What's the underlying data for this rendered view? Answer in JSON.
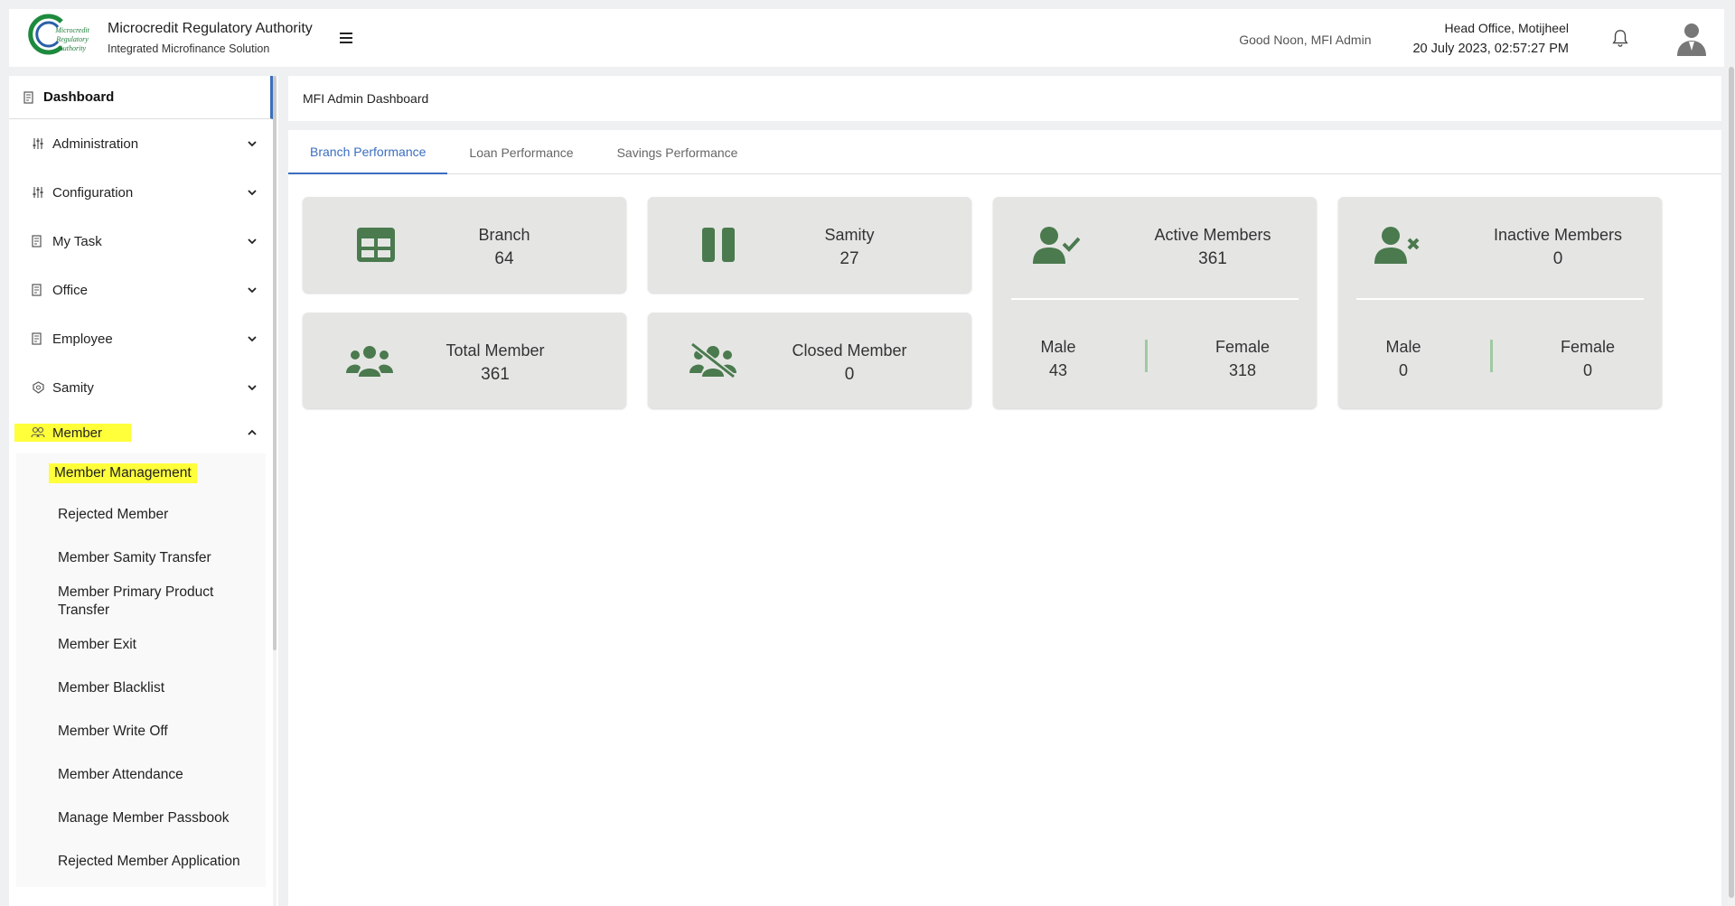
{
  "header": {
    "logo_text": [
      "Microcredit",
      "Regulatory",
      "Authority"
    ],
    "title": "Microcredit Regulatory Authority",
    "subtitle": "Integrated Microfinance Solution",
    "greeting": "Good Noon, MFI Admin",
    "office": "Head Office, Motijheel",
    "datetime": "20 July 2023, 02:57:27 PM",
    "icons": {
      "menu": "hamburger-icon",
      "notify": "bell-icon",
      "user": "user-avatar-icon"
    }
  },
  "sidebar": {
    "dashboard": "Dashboard",
    "items": [
      {
        "label": "Administration",
        "icon": "sliders-icon"
      },
      {
        "label": "Configuration",
        "icon": "sliders-icon"
      },
      {
        "label": "My Task",
        "icon": "task-icon"
      },
      {
        "label": "Office",
        "icon": "office-icon"
      },
      {
        "label": "Employee",
        "icon": "employee-icon"
      },
      {
        "label": "Samity",
        "icon": "samity-icon"
      }
    ],
    "member": "Member",
    "member_sub": [
      "Member Management",
      "Rejected Member",
      "Member Samity Transfer",
      "Member Primary Product Transfer",
      "Member Exit",
      "Member Blacklist",
      "Member Write Off",
      "Member Attendance",
      "Manage Member Passbook",
      "Rejected Member Application"
    ],
    "highlight_color": "#ffff3a"
  },
  "main": {
    "title": "MFI Admin Dashboard",
    "tabs": [
      "Branch Performance",
      "Loan Performance",
      "Savings Performance"
    ],
    "active_tab": "Branch Performance",
    "accent_color": "#3a6ebf",
    "icon_color": "#4a7a4e",
    "cards": {
      "branch": {
        "label": "Branch",
        "value": "64"
      },
      "samity": {
        "label": "Samity",
        "value": "27"
      },
      "total_member": {
        "label": "Total Member",
        "value": "361"
      },
      "closed_member": {
        "label": "Closed Member",
        "value": "0"
      },
      "active_members": {
        "label": "Active Members",
        "value": "361",
        "male_label": "Male",
        "male": "43",
        "female_label": "Female",
        "female": "318"
      },
      "inactive_members": {
        "label": "Inactive Members",
        "value": "0",
        "male_label": "Male",
        "male": "0",
        "female_label": "Female",
        "female": "0"
      }
    }
  }
}
